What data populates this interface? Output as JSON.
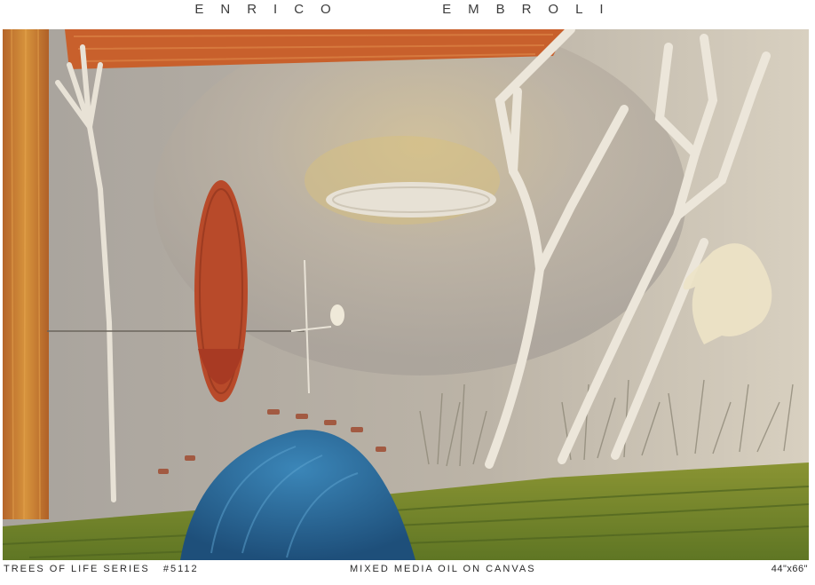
{
  "header": {
    "artist_first": "ENRICO",
    "artist_last": "EMBROLI"
  },
  "painting": {
    "subject": "abstract landscape with white trees, red leaf shape, blue mound and green ground"
  },
  "footer": {
    "series": "TREES OF LIFE SERIES",
    "number": "#5112",
    "medium": "MIXED MEDIA OIL ON CANVAS",
    "size": "44\"x66\""
  },
  "colors": {
    "wall": "#b8b1a8",
    "orange_band": "#c8602c",
    "post": "#c97a32",
    "red_leaf": "#b84a2a",
    "blue_mound": "#2f6e9e",
    "green_ground": "#7a8a2e",
    "white_trees": "#ece6da"
  }
}
